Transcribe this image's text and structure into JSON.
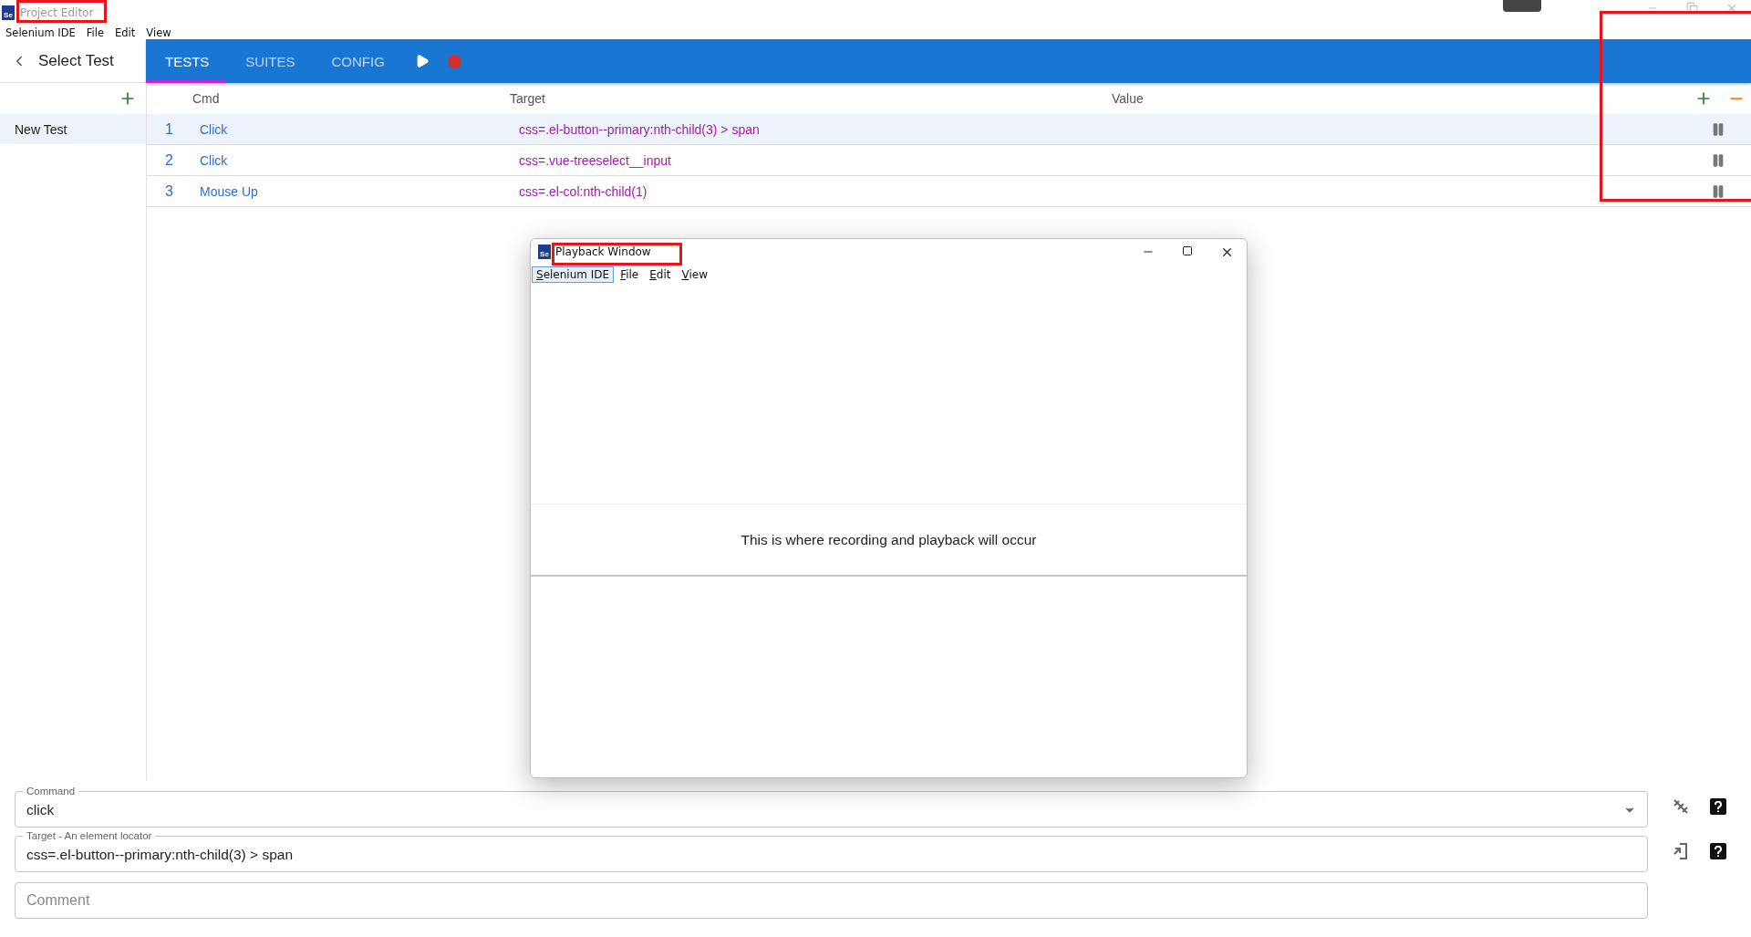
{
  "window": {
    "logo_text": "Se",
    "title": "Project Editor",
    "menu": [
      "Selenium IDE",
      "File",
      "Edit",
      "View"
    ]
  },
  "header": {
    "back_label": "Select Test",
    "tabs": [
      {
        "label": "TESTS",
        "selected": true
      },
      {
        "label": "SUITES",
        "selected": false
      },
      {
        "label": "CONFIG",
        "selected": false
      }
    ],
    "recording": true
  },
  "sidebar": {
    "items": [
      {
        "label": "New Test",
        "selected": true
      }
    ]
  },
  "table": {
    "columns": [
      "Cmd",
      "Target",
      "Value"
    ],
    "rows": [
      {
        "index": "1",
        "command": "Click",
        "target": "css=.el-button--primary:nth-child(3) > span",
        "selected": true
      },
      {
        "index": "2",
        "command": "Click",
        "target": "css=.vue-treeselect__input",
        "selected": false
      },
      {
        "index": "3",
        "command": "Mouse Up",
        "target": "css=.el-col:nth-child(1)",
        "selected": false
      }
    ]
  },
  "playback_window": {
    "logo_text": "Se",
    "title": "Playback Window",
    "menu": [
      {
        "label": "Selenium IDE",
        "selected": true
      },
      {
        "label": "File",
        "selected": false
      },
      {
        "label": "Edit",
        "selected": false
      },
      {
        "label": "View",
        "selected": false
      }
    ],
    "message": "This is where recording and playback will occur"
  },
  "editor": {
    "command": {
      "label": "Command",
      "value": "click"
    },
    "target": {
      "label": "Target - An element locator",
      "value": "css=.el-button--primary:nth-child(3) > span"
    },
    "comment": {
      "placeholder": "Comment"
    }
  }
}
